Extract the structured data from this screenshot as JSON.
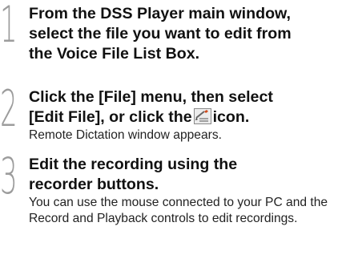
{
  "steps": [
    {
      "number": "1",
      "heading_lines": [
        "From the DSS Player main window,",
        "select the file you want to edit from",
        "the Voice File List Box."
      ]
    },
    {
      "number": "2",
      "heading_line1": "Click the [File] menu, then select",
      "heading_line2_before_icon": "[Edit File], or click the",
      "heading_line2_after_icon": "icon.",
      "icon": "edit-file-icon",
      "description": "Remote Dictation window appears."
    },
    {
      "number": "3",
      "heading_lines": [
        "Edit the recording using the",
        "recorder buttons."
      ],
      "description": "You can use the mouse connected to your PC and the Record and Playback controls to edit recordings."
    }
  ]
}
